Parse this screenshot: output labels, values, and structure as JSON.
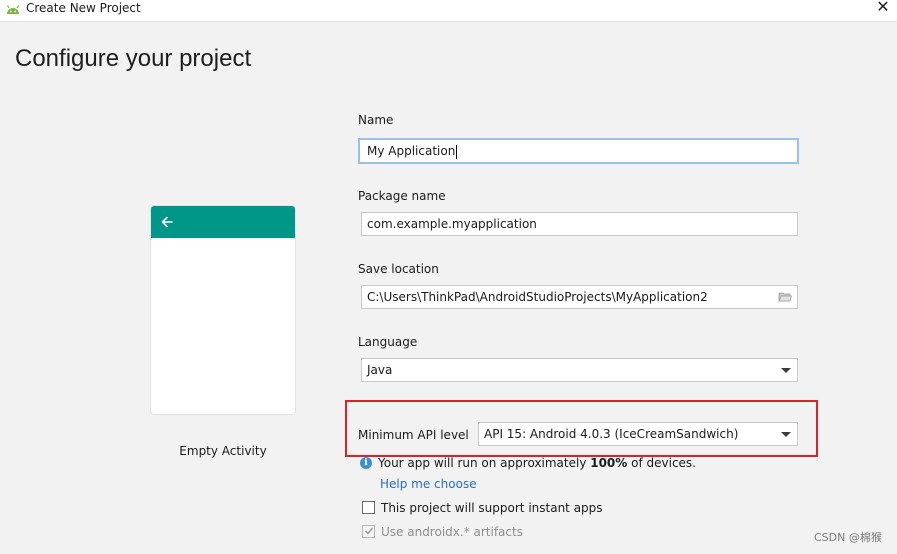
{
  "window": {
    "title": "Create New Project",
    "icon": "android-icon",
    "close_glyph": "✕"
  },
  "page": {
    "title": "Configure your project"
  },
  "preview": {
    "accent_color": "#009688",
    "activity_label": "Empty Activity"
  },
  "form": {
    "name": {
      "label": "Name",
      "value": "My Application"
    },
    "package": {
      "label": "Package name",
      "value": "com.example.myapplication"
    },
    "location": {
      "label": "Save location",
      "value": "C:\\Users\\ThinkPad\\AndroidStudioProjects\\MyApplication2"
    },
    "language": {
      "label": "Language",
      "value": "Java"
    },
    "min_api": {
      "label": "Minimum API level",
      "value": "API 15: Android 4.0.3 (IceCreamSandwich)"
    }
  },
  "info": {
    "before": "Your app will run on approximately ",
    "percent": "100%",
    "after": " of devices.",
    "help_link": "Help me choose"
  },
  "checkboxes": {
    "instant_apps": {
      "label": "This project will support instant apps",
      "checked": false
    },
    "androidx": {
      "label": "Use androidx.* artifacts",
      "checked": true,
      "disabled": true
    }
  },
  "highlight_color": "#d9232a",
  "watermark": "CSDN @棉猴"
}
